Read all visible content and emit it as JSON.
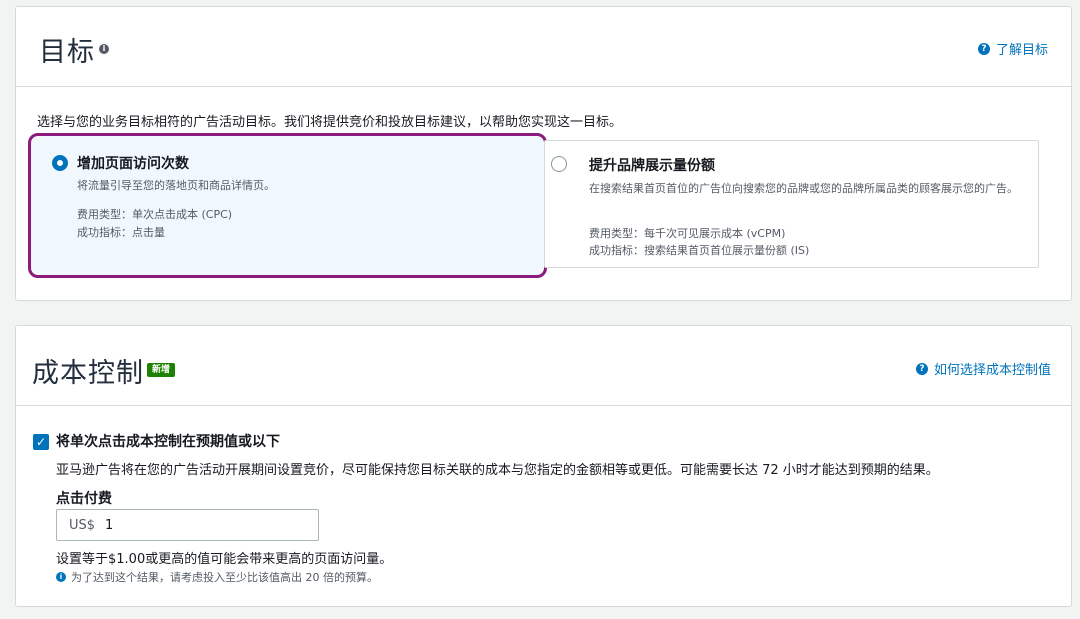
{
  "goal": {
    "title": "目标",
    "info_icon": "i",
    "help_link": "了解目标",
    "intro": "选择与您的业务目标相符的广告活动目标。我们将提供竞价和投放目标建议，以帮助您实现这一目标。",
    "options": [
      {
        "title": "增加页面访问次数",
        "desc": "将流量引导至您的落地页和商品详情页。",
        "cost_type": "费用类型：单次点击成本 (CPC)",
        "metric": "成功指标：点击量",
        "selected": true
      },
      {
        "title": "提升品牌展示量份额",
        "desc": "在搜索结果首页首位的广告位向搜索您的品牌或您的品牌所属品类的顾客展示您的广告。",
        "cost_type": "费用类型：每千次可见展示成本 (vCPM)",
        "metric": "成功指标：搜索结果首页首位展示量份额 (IS)",
        "selected": false
      }
    ]
  },
  "cost": {
    "title": "成本控制",
    "badge": "新增",
    "help_link": "如何选择成本控制值",
    "checkbox_label": "将单次点击成本控制在预期值或以下",
    "checkbox_checked": true,
    "desc": "亚马逊广告将在您的广告活动开展期间设置竞价，尽可能保持您目标关联的成本与您指定的金额相等或更低。可能需要长达 72 小时才能达到预期的结果。",
    "field_label": "点击付费",
    "currency": "US$",
    "value": "1",
    "hint": "设置等于$1.00或更高的值可能会带来更高的页面访问量。",
    "hint2": "为了达到这个结果，请考虑投入至少比该值高出 20 倍的预算。"
  },
  "colors": {
    "accent": "#0073bb",
    "highlight_border": "#8c1b7e",
    "badge": "#1d8102"
  }
}
